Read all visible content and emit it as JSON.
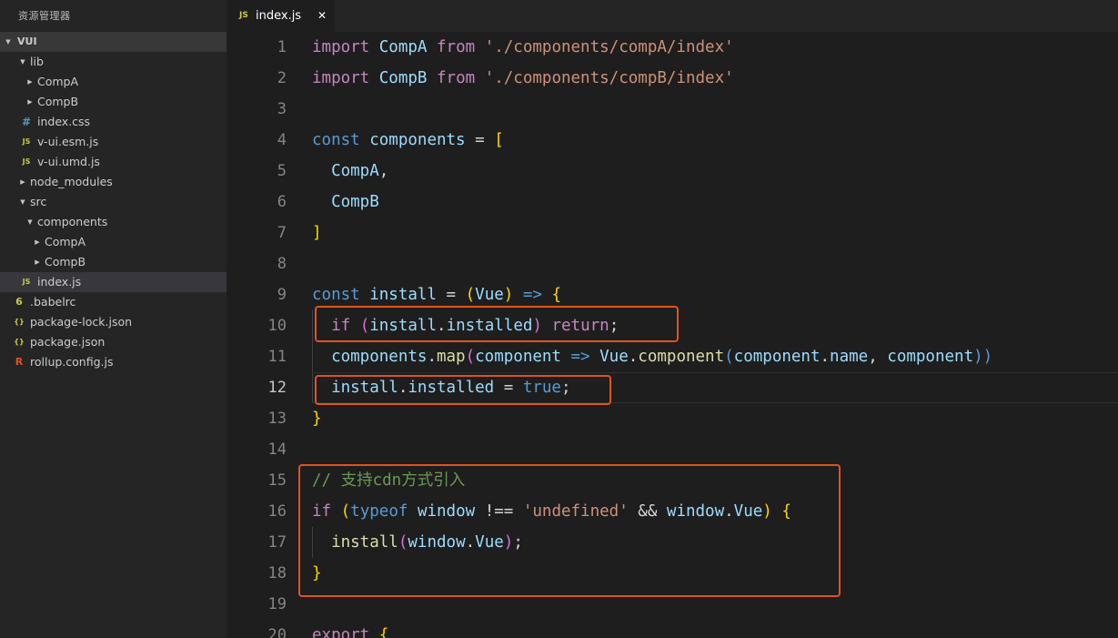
{
  "sidebar": {
    "title": "资源管理器",
    "project": "VUI",
    "tree": [
      {
        "label": "lib",
        "kind": "folder-open",
        "depth": 1
      },
      {
        "label": "CompA",
        "kind": "folder",
        "depth": 2
      },
      {
        "label": "CompB",
        "kind": "folder",
        "depth": 2
      },
      {
        "label": "index.css",
        "kind": "css",
        "depth": 2
      },
      {
        "label": "v-ui.esm.js",
        "kind": "js",
        "depth": 2
      },
      {
        "label": "v-ui.umd.js",
        "kind": "js",
        "depth": 2
      },
      {
        "label": "node_modules",
        "kind": "folder",
        "depth": 1
      },
      {
        "label": "src",
        "kind": "folder-open",
        "depth": 1
      },
      {
        "label": "components",
        "kind": "folder-open",
        "depth": 2
      },
      {
        "label": "CompA",
        "kind": "folder",
        "depth": 3
      },
      {
        "label": "CompB",
        "kind": "folder",
        "depth": 3
      },
      {
        "label": "index.js",
        "kind": "js",
        "depth": 2,
        "selected": true
      },
      {
        "label": ".babelrc",
        "kind": "babel",
        "depth": 1
      },
      {
        "label": "package-lock.json",
        "kind": "json",
        "depth": 1
      },
      {
        "label": "package.json",
        "kind": "json",
        "depth": 1
      },
      {
        "label": "rollup.config.js",
        "kind": "rollup",
        "depth": 1
      }
    ]
  },
  "icons": {
    "js": {
      "glyph": "JS",
      "color": "#cbcb41"
    },
    "css": {
      "glyph": "#",
      "color": "#519aba"
    },
    "json": {
      "glyph": "{}",
      "color": "#cbcb41"
    },
    "babel": {
      "glyph": "6",
      "color": "#cbcb41"
    },
    "rollup": {
      "glyph": "R",
      "color": "#e0531f"
    },
    "folder": {
      "glyph": "▶",
      "color": "#c5c5c5"
    },
    "folder-open": {
      "glyph": "▼",
      "color": "#c5c5c5"
    }
  },
  "tab": {
    "icon": "JS",
    "label": "index.js",
    "close": "✕"
  },
  "highlight_color": "#e0531f",
  "active_line": 12,
  "code": [
    [
      [
        "kw",
        "import"
      ],
      [
        "op",
        " "
      ],
      [
        "va",
        "CompA"
      ],
      [
        "op",
        " "
      ],
      [
        "kw",
        "from"
      ],
      [
        "op",
        " "
      ],
      [
        "st",
        "'./components/compA/index'"
      ]
    ],
    [
      [
        "kw",
        "import"
      ],
      [
        "op",
        " "
      ],
      [
        "va",
        "CompB"
      ],
      [
        "op",
        " "
      ],
      [
        "kw",
        "from"
      ],
      [
        "op",
        " "
      ],
      [
        "st",
        "'./components/compB/index'"
      ]
    ],
    [],
    [
      [
        "sto",
        "const"
      ],
      [
        "op",
        " "
      ],
      [
        "va",
        "components"
      ],
      [
        "op",
        " = "
      ],
      [
        "b1",
        "["
      ]
    ],
    [
      [
        "op",
        "  "
      ],
      [
        "va",
        "CompA"
      ],
      [
        "op",
        ","
      ]
    ],
    [
      [
        "op",
        "  "
      ],
      [
        "va",
        "CompB"
      ]
    ],
    [
      [
        "b1",
        "]"
      ]
    ],
    [],
    [
      [
        "sto",
        "const"
      ],
      [
        "op",
        " "
      ],
      [
        "va",
        "install"
      ],
      [
        "op",
        " = "
      ],
      [
        "b1",
        "("
      ],
      [
        "va",
        "Vue"
      ],
      [
        "b1",
        ")"
      ],
      [
        "op",
        " "
      ],
      [
        "sto",
        "=>"
      ],
      [
        "op",
        " "
      ],
      [
        "b1",
        "{"
      ]
    ],
    [
      [
        "op",
        "  "
      ],
      [
        "kw",
        "if"
      ],
      [
        "op",
        " "
      ],
      [
        "b2",
        "("
      ],
      [
        "va",
        "install"
      ],
      [
        "op",
        "."
      ],
      [
        "va",
        "installed"
      ],
      [
        "b2",
        ")"
      ],
      [
        "op",
        " "
      ],
      [
        "kw",
        "return"
      ],
      [
        "op",
        ";"
      ]
    ],
    [
      [
        "op",
        "  "
      ],
      [
        "va",
        "components"
      ],
      [
        "op",
        "."
      ],
      [
        "fn",
        "map"
      ],
      [
        "b2",
        "("
      ],
      [
        "va",
        "component"
      ],
      [
        "op",
        " "
      ],
      [
        "sto",
        "=>"
      ],
      [
        "op",
        " "
      ],
      [
        "va",
        "Vue"
      ],
      [
        "op",
        "."
      ],
      [
        "fn",
        "component"
      ],
      [
        "sto",
        "("
      ],
      [
        "va",
        "component"
      ],
      [
        "op",
        "."
      ],
      [
        "va",
        "name"
      ],
      [
        "op",
        ", "
      ],
      [
        "va",
        "component"
      ],
      [
        "sto",
        "))"
      ]
    ],
    [
      [
        "op",
        "  "
      ],
      [
        "va",
        "install"
      ],
      [
        "op",
        "."
      ],
      [
        "va",
        "installed"
      ],
      [
        "op",
        " = "
      ],
      [
        "sto",
        "true"
      ],
      [
        "op",
        ";"
      ]
    ],
    [
      [
        "b1",
        "}"
      ]
    ],
    [],
    [
      [
        "cm",
        "// 支持cdn方式引入"
      ]
    ],
    [
      [
        "kw",
        "if"
      ],
      [
        "op",
        " "
      ],
      [
        "b1",
        "("
      ],
      [
        "sto",
        "typeof"
      ],
      [
        "op",
        " "
      ],
      [
        "va",
        "window"
      ],
      [
        "op",
        " !== "
      ],
      [
        "st",
        "'undefined'"
      ],
      [
        "op",
        " && "
      ],
      [
        "va",
        "window"
      ],
      [
        "op",
        "."
      ],
      [
        "va",
        "Vue"
      ],
      [
        "b1",
        ")"
      ],
      [
        "op",
        " "
      ],
      [
        "b1",
        "{"
      ]
    ],
    [
      [
        "op",
        "  "
      ],
      [
        "fn",
        "install"
      ],
      [
        "b2",
        "("
      ],
      [
        "va",
        "window"
      ],
      [
        "op",
        "."
      ],
      [
        "va",
        "Vue"
      ],
      [
        "b2",
        ")"
      ],
      [
        "op",
        ";"
      ]
    ],
    [
      [
        "b1",
        "}"
      ]
    ],
    [],
    [
      [
        "kw",
        "export"
      ],
      [
        "op",
        " "
      ],
      [
        "b1",
        "{"
      ]
    ]
  ]
}
